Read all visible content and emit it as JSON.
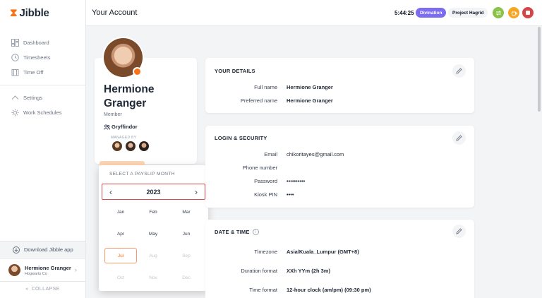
{
  "app": {
    "logo_text": "Jibble"
  },
  "sidebar": {
    "items": [
      {
        "label": "Dashboard",
        "icon": "dashboard-icon"
      },
      {
        "label": "Timesheets",
        "icon": "clock-icon"
      },
      {
        "label": "Time Off",
        "icon": "time-off-icon"
      }
    ],
    "items2": [
      {
        "label": "Settings",
        "icon": "chevron-up-icon"
      },
      {
        "label": "Work Schedules",
        "icon": "work-schedules-icon"
      }
    ],
    "download_label": "Download Jibble app",
    "user": {
      "name": "Hermione Granger",
      "org": "Hogwarts Co"
    },
    "collapse_label": "COLLAPSE"
  },
  "header": {
    "title": "Your Account",
    "timer": "5:44:25",
    "activity": "Divination",
    "project": "Project Hagrid"
  },
  "profile": {
    "name": "Hermione Granger",
    "role": "Member",
    "team": "Gryffindor",
    "managed_by_label": "MANAGED BY"
  },
  "payslip": {
    "label": "SELECT A PAYSLIP MONTH",
    "year": "2023",
    "months": [
      {
        "label": "Jan",
        "state": "enabled"
      },
      {
        "label": "Feb",
        "state": "enabled"
      },
      {
        "label": "Mar",
        "state": "enabled"
      },
      {
        "label": "Apr",
        "state": "enabled"
      },
      {
        "label": "May",
        "state": "enabled"
      },
      {
        "label": "Jun",
        "state": "enabled"
      },
      {
        "label": "Jul",
        "state": "selected"
      },
      {
        "label": "Aug",
        "state": "disabled"
      },
      {
        "label": "Sep",
        "state": "disabled"
      },
      {
        "label": "Oct",
        "state": "disabled"
      },
      {
        "label": "Nov",
        "state": "disabled"
      },
      {
        "label": "Dec",
        "state": "disabled"
      }
    ]
  },
  "your_details": {
    "title": "YOUR DETAILS",
    "rows": [
      {
        "label": "Full name",
        "value": "Hermione Granger"
      },
      {
        "label": "Preferred name",
        "value": "Hermione Granger"
      }
    ]
  },
  "login_security": {
    "title": "LOGIN & SECURITY",
    "rows": [
      {
        "label": "Email",
        "value": "chikoritayes@gmail.com"
      },
      {
        "label": "Phone number",
        "value": ""
      },
      {
        "label": "Password",
        "value": "••••••••••"
      },
      {
        "label": "Kiosk PIN",
        "value": "••••"
      }
    ]
  },
  "date_time": {
    "title": "DATE & TIME",
    "rows": [
      {
        "label": "Timezone",
        "value": "Asia/Kuala_Lumpur (GMT+8)"
      },
      {
        "label": "Duration format",
        "value": "XXh YYm (2h 3m)"
      },
      {
        "label": "Time format",
        "value": "12-hour clock (am/pm) (09:30 pm)"
      }
    ]
  },
  "colors": {
    "brand_orange": "#f97316",
    "activity_purple": "#7c6cf2",
    "highlight_red": "#e24b4b",
    "switch_green": "#8bc34a",
    "break_orange": "#f5a623",
    "stop_red": "#d64545"
  }
}
